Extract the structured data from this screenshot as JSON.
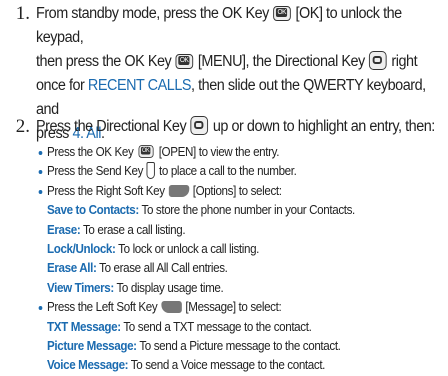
{
  "step1": {
    "number": "1.",
    "line1_a": "From standby mode, press the OK Key",
    "line1_b": "[OK] to unlock the keypad,",
    "line2_a": "then press the OK Key",
    "line2_b": "[MENU], the Directional Key",
    "line2_c": "right",
    "line3_a": "once for",
    "recent_calls": "RECENT CALLS",
    "line3_b": ", then slide out the QWERTY keyboard, and",
    "line4_a": "press",
    "all_option": "4. All",
    "line4_b": "."
  },
  "step2": {
    "number": "2.",
    "intro_a": "Press the Directional Key",
    "intro_b": "up or down to highlight an entry, then:",
    "b1_a": "Press the OK Key",
    "b1_b": "[OPEN] to view the entry.",
    "b2_a": "Press the Send Key",
    "b2_b": "to place a call to the number.",
    "b3_a": "Press the Right Soft Key",
    "b3_b": "[Options] to select:",
    "options": [
      {
        "term": "Save to Contacts:",
        "desc": " To store the phone number in your Contacts."
      },
      {
        "term": "Erase:",
        "desc": " To erase a call listing."
      },
      {
        "term": "Lock/Unlock:",
        "desc": " To lock or unlock a call listing."
      },
      {
        "term": "Erase All:",
        "desc": " To erase all All Call entries."
      },
      {
        "term": "View Timers:",
        "desc": " To display usage time."
      }
    ],
    "b4_a": "Press the Left Soft Key",
    "b4_b": "[Message] to select:",
    "messages": [
      {
        "term": "TXT Message:",
        "desc": " To send a TXT message to the contact."
      },
      {
        "term": "Picture Message:",
        "desc": " To send a Picture message to the contact."
      },
      {
        "term": "Voice Message:",
        "desc": " To send a Voice message to the contact."
      }
    ]
  },
  "icons": {
    "ok_key": "ok-key-icon",
    "directional_key": "directional-key-icon",
    "send_key": "send-key-icon",
    "right_soft_key": "right-soft-key-icon",
    "left_soft_key": "left-soft-key-icon"
  },
  "colors": {
    "accent": "#1b6bb0",
    "text": "#222222"
  }
}
